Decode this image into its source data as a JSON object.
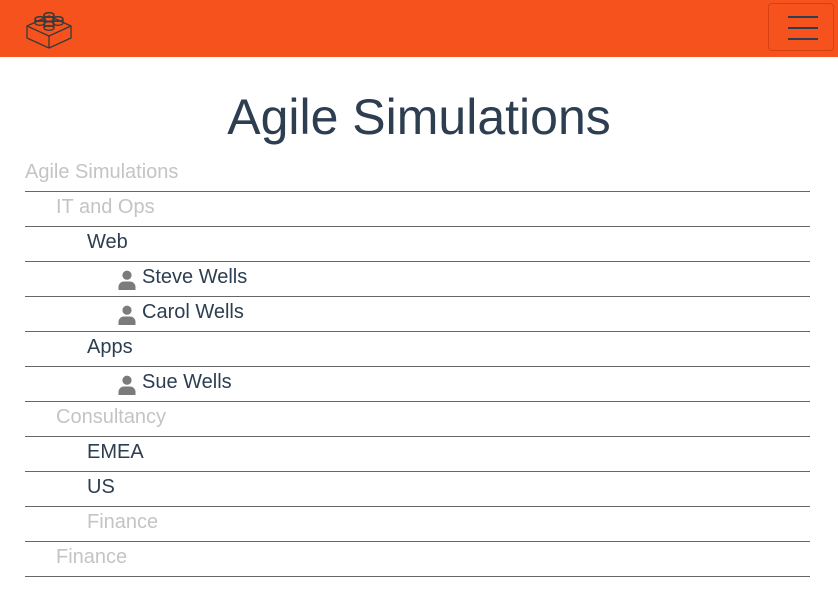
{
  "navbar": {
    "brand_icon": "lego-brick-icon",
    "menu_icon": "hamburger-menu-icon",
    "brand_color": "#f5521e"
  },
  "page": {
    "title": "Agile Simulations"
  },
  "tree": {
    "items": [
      {
        "label": "Agile Simulations",
        "level": 0,
        "type": "group",
        "muted": true
      },
      {
        "label": "IT and Ops",
        "level": 1,
        "type": "group",
        "muted": true
      },
      {
        "label": "Web",
        "level": 2,
        "type": "team",
        "muted": false
      },
      {
        "label": "Steve Wells",
        "level": 3,
        "type": "person",
        "icon": "person-icon",
        "muted": false
      },
      {
        "label": "Carol Wells",
        "level": 3,
        "type": "person",
        "icon": "person-icon",
        "muted": false
      },
      {
        "label": "Apps",
        "level": 2,
        "type": "team",
        "muted": false
      },
      {
        "label": "Sue Wells",
        "level": 3,
        "type": "person",
        "icon": "person-icon",
        "muted": false
      },
      {
        "label": "Consultancy",
        "level": 1,
        "type": "group",
        "muted": true
      },
      {
        "label": "EMEA",
        "level": 2,
        "type": "team",
        "muted": false
      },
      {
        "label": "US",
        "level": 2,
        "type": "team",
        "muted": false
      },
      {
        "label": "Finance",
        "level": 2,
        "type": "group",
        "muted": true
      },
      {
        "label": "Finance",
        "level": 1,
        "type": "group",
        "muted": true
      }
    ]
  }
}
